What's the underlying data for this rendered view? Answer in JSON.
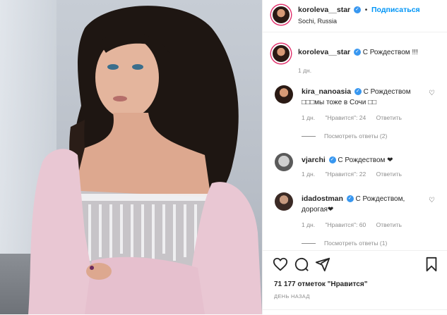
{
  "post": {
    "author": {
      "username": "koroleva__star",
      "follow_label": "Подписаться",
      "location": "Sochi, Russia",
      "dot": "•"
    },
    "caption": {
      "username": "koroleva__star",
      "text": "С Рождеством !!!",
      "time": "1 дн."
    },
    "comments": [
      {
        "username": "kira_nanoasia",
        "text_line1": "С Рождеством",
        "text_line2": "□□□мы тоже в Сочи □□",
        "time": "1 дн.",
        "likes": "\"Нравится\": 24",
        "reply": "Ответить",
        "view_replies": "Посмотреть ответы (2)"
      },
      {
        "username": "vjarchi",
        "text_line1": "С Рождеством ❤",
        "time": "1 дн.",
        "likes": "\"Нравится\": 22",
        "reply": "Ответить"
      },
      {
        "username": "idadostman",
        "text_line1": "С Рождеством,",
        "text_line2": "дорогая❤",
        "time": "1 дн.",
        "likes": "\"Нравится\": 60",
        "reply": "Ответить",
        "view_replies": "Посмотреть ответы (1)"
      }
    ],
    "likes_count": "71 177 отметок \"Нравится\"",
    "date_label": "ДЕНЬ НАЗАД",
    "icons": {
      "like": "heart-icon",
      "comment": "comment-icon",
      "share": "share-icon",
      "save": "bookmark-icon",
      "verified": "verified-badge-icon"
    },
    "colors": {
      "accent": "#0095f6",
      "verified": "#3897f0",
      "muted": "#8e8e8e"
    }
  }
}
